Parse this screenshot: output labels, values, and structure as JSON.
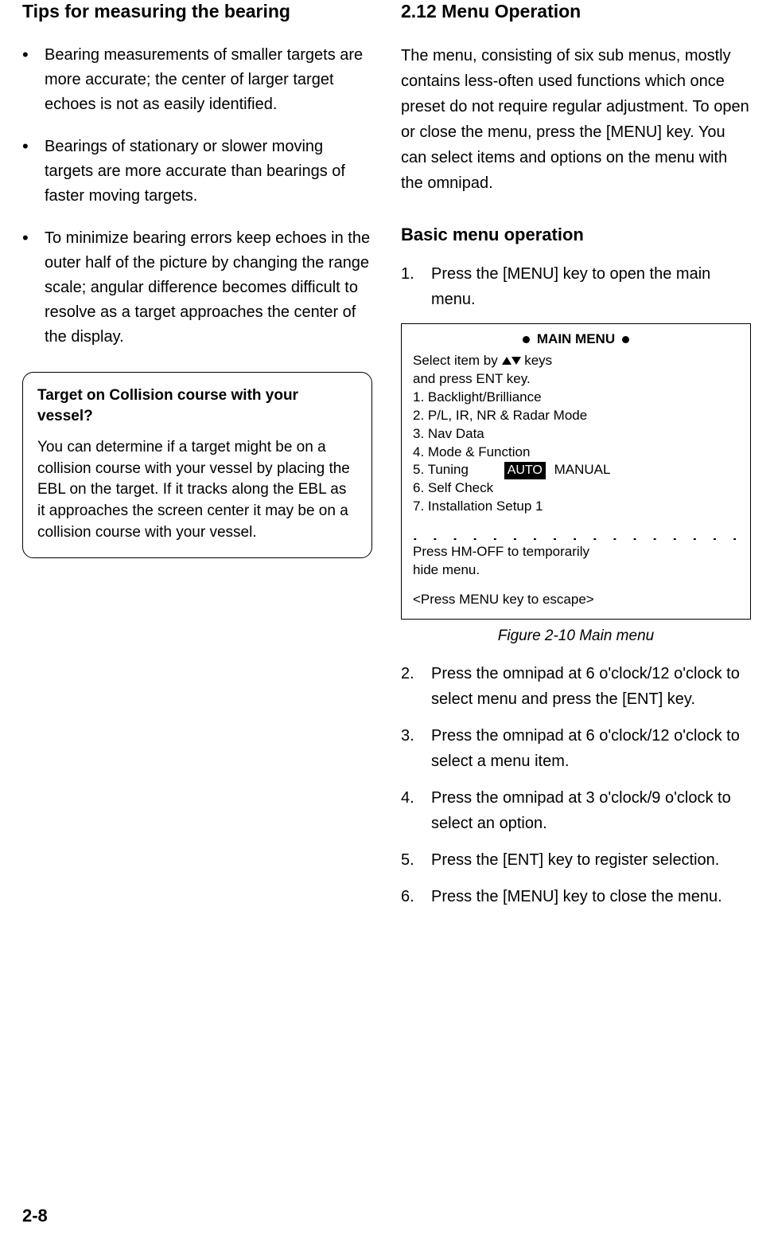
{
  "left": {
    "heading": "Tips for measuring the bearing",
    "bullets": [
      "Bearing measurements of smaller targets are more accurate; the center of larger target echoes is not as easily identified.",
      "Bearings of stationary or slower moving targets are more accurate than bearings of faster moving targets.",
      "To minimize bearing errors keep echoes in the outer half of the picture by changing the range scale; angular difference becomes difficult to resolve as a target approaches the center of the display."
    ],
    "callout": {
      "title": "Target on Collision course with your vessel?",
      "body": "You can determine if a target might be on a collision course with your vessel by placing the EBL on the target. If it tracks along the EBL as it approaches the screen center it may be on a collision course with your vessel."
    }
  },
  "right": {
    "heading": "2.12 Menu Operation",
    "intro": "The menu, consisting of six sub menus, mostly contains less-often used functions which once preset do not require regular adjustment. To open or close the menu, press the [MENU] key. You can select items and options on the menu with the omnipad.",
    "subheading": "Basic menu operation",
    "steps_before_figure": [
      "Press the [MENU] key to open the main menu."
    ],
    "menu": {
      "title": "MAIN MENU",
      "select_prefix": "Select item by ",
      "select_suffix": " keys",
      "press_ent": "and press ENT key.",
      "items": [
        "1. Backlight/Brilliance",
        "2. P/L, IR, NR & Radar Mode",
        "3. Nav Data",
        "4. Mode & Function"
      ],
      "tuning_label": "5. Tuning",
      "tuning_auto": "AUTO",
      "tuning_manual": "MANUAL",
      "items_after": [
        "6. Self Check",
        "7. Installation Setup 1"
      ],
      "hmoff_1": "Press HM-OFF to temporarily",
      "hmoff_2": "hide menu.",
      "escape": "<Press MENU key to escape>"
    },
    "figure_caption": "Figure 2-10 Main menu",
    "steps_after_figure": [
      "Press the omnipad at 6 o'clock/12 o'clock to select menu and press the [ENT] key.",
      "Press the omnipad at 6 o'clock/12 o'clock to select a menu item.",
      "Press the omnipad at 3 o'clock/9 o'clock to select an option.",
      "Press the [ENT] key to register selection.",
      "Press the [MENU] key to close the menu."
    ]
  },
  "page_number": "2-8"
}
